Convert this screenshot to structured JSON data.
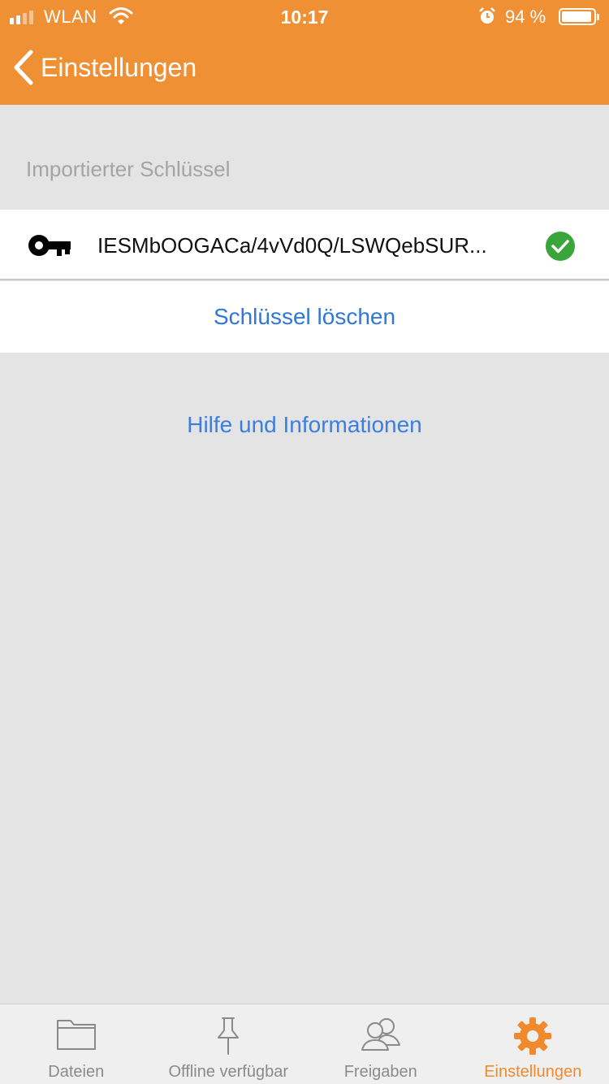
{
  "status_bar": {
    "carrier": "WLAN",
    "time": "10:17",
    "battery": "94 %",
    "battery_level": 0.94
  },
  "nav": {
    "back_label": "Einstellungen"
  },
  "section": {
    "label": "Importierter Schlüssel"
  },
  "key_row": {
    "key_value": "IESMbOOGACa/4vVd0Q/LSWQebSUR...",
    "status": "verified"
  },
  "actions": {
    "delete_key": "Schlüssel löschen",
    "help": "Hilfe und Informationen"
  },
  "tabbar": {
    "tabs": [
      {
        "label": "Dateien",
        "icon": "folder-icon",
        "active": false
      },
      {
        "label": "Offline verfügbar",
        "icon": "pin-icon",
        "active": false
      },
      {
        "label": "Freigaben",
        "icon": "people-icon",
        "active": false
      },
      {
        "label": "Einstellungen",
        "icon": "gear-icon",
        "active": true
      }
    ]
  },
  "colors": {
    "header": "#f09035",
    "link": "#2f77d8",
    "active_tab": "#f08a2c",
    "check": "#3aa53a"
  }
}
